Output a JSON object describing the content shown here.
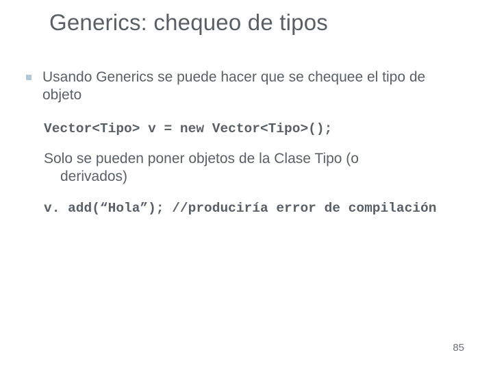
{
  "slide": {
    "title": "Generics: chequeo de tipos",
    "bullet1": "Usando Generics se puede hacer que se chequee el tipo de objeto",
    "code1": "Vector<Tipo> v = new Vector<Tipo>();",
    "para2_line1": "Solo se pueden poner objetos de la Clase Tipo (o",
    "para2_line2": "derivados)",
    "code2": "v. add(“Hola”); //produciría error de compilación",
    "page": "85"
  }
}
